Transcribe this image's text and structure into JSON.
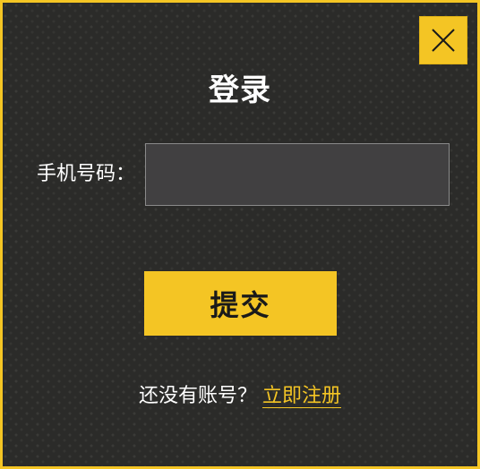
{
  "dialog": {
    "title": "登录",
    "close_icon": "close-icon",
    "phone_label": "手机号码：",
    "phone_value": "",
    "phone_placeholder": "",
    "submit_label": "提交",
    "register_prompt": "还没有账号？",
    "register_link": "立即注册"
  },
  "colors": {
    "accent": "#f4c524",
    "background": "#2b2b29",
    "input_bg": "#414041"
  }
}
